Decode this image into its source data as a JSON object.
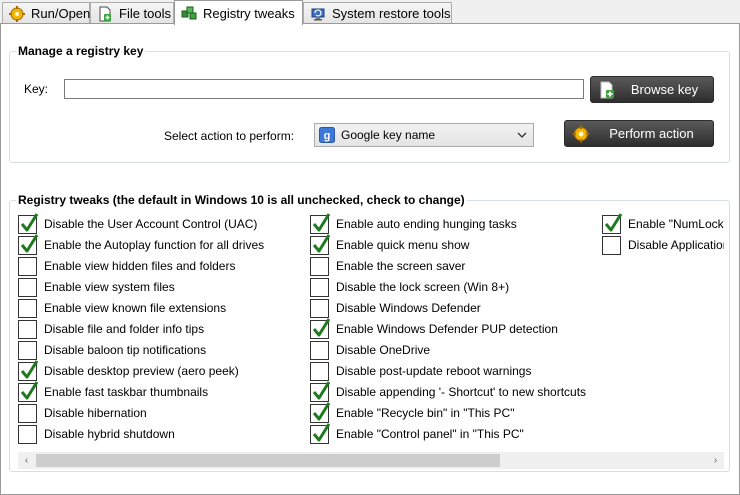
{
  "tabs": [
    {
      "label": "Run/Open",
      "icon": "gear-run-icon"
    },
    {
      "label": "File tools",
      "icon": "file-add-icon"
    },
    {
      "label": "Registry tweaks",
      "icon": "registry-cubes-icon",
      "active": true
    },
    {
      "label": "System restore tools",
      "icon": "system-restore-icon"
    }
  ],
  "manage": {
    "title": "Manage a registry key",
    "key_label": "Key:",
    "key_value": "",
    "browse_label": "Browse key",
    "action_label": "Select action to perform:",
    "action_selected": "Google key name",
    "perform_label": "Perform action"
  },
  "tweaks": {
    "title": "Registry tweaks (the default in Windows 10 is all unchecked, check to change)",
    "columns": [
      [
        {
          "label": "Disable the User Account Control (UAC)",
          "checked": true
        },
        {
          "label": "Enable the Autoplay function for all drives",
          "checked": true
        },
        {
          "label": "Enable view hidden files and folders",
          "checked": false
        },
        {
          "label": "Enable view system files",
          "checked": false
        },
        {
          "label": "Enable view known file extensions",
          "checked": false
        },
        {
          "label": "Disable file and folder info tips",
          "checked": false
        },
        {
          "label": "Disable baloon tip notifications",
          "checked": false
        },
        {
          "label": "Disable desktop preview (aero peek)",
          "checked": true
        },
        {
          "label": "Enable fast taskbar thumbnails",
          "checked": true
        },
        {
          "label": "Disable hibernation",
          "checked": false
        },
        {
          "label": "Disable hybrid shutdown",
          "checked": false
        }
      ],
      [
        {
          "label": "Enable auto ending hunging tasks",
          "checked": true
        },
        {
          "label": "Enable quick menu show",
          "checked": true
        },
        {
          "label": "Enable the screen saver",
          "checked": false
        },
        {
          "label": "Disable the lock screen (Win 8+)",
          "checked": false
        },
        {
          "label": "Disable Windows Defender",
          "checked": false
        },
        {
          "label": "Enable Windows Defender PUP detection",
          "checked": true
        },
        {
          "label": "Disable OneDrive",
          "checked": false
        },
        {
          "label": "Disable post-update reboot warnings",
          "checked": false
        },
        {
          "label": "Disable appending '- Shortcut' to new shortcuts",
          "checked": true
        },
        {
          "label": "Enable \"Recycle bin\" in \"This PC\"",
          "checked": true
        },
        {
          "label": "Enable \"Control panel\" in \"This PC\"",
          "checked": true
        }
      ],
      [
        {
          "label": "Enable \"NumLock\" on logon",
          "checked": true
        },
        {
          "label": "Disable Application Telemetry",
          "checked": false
        }
      ]
    ]
  },
  "scroll": {
    "left_arrow": "‹",
    "right_arrow": "›"
  }
}
